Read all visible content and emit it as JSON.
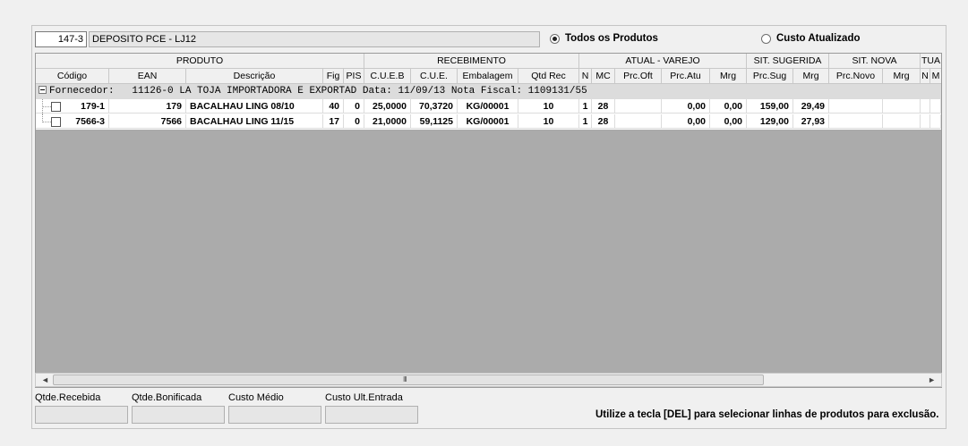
{
  "store": {
    "code": "147-3",
    "name": "DEPOSITO PCE - LJ12"
  },
  "filter": {
    "all_products": {
      "label": "Todos os Produtos",
      "selected": true
    },
    "updated_cost": {
      "label": "Custo Atualizado",
      "selected": false
    }
  },
  "grid": {
    "groups": [
      "PRODUTO",
      "RECEBIMENTO",
      "ATUAL - VAREJO",
      "SIT. SUGERIDA",
      "SIT. NOVA",
      "TUA"
    ],
    "columns": [
      "Código",
      "EAN",
      "Descrição",
      "Fig",
      "PIS",
      "C.U.E.B",
      "C.U.E.",
      "Embalagem",
      "Qtd Rec",
      "N",
      "MC",
      "Prc.Oft",
      "Prc.Atu",
      "Mrg",
      "Prc.Sug",
      "Mrg",
      "Prc.Novo",
      "Mrg",
      "N",
      "M"
    ],
    "supplier_row": "Fornecedor:   11126-0 LA TOJA IMPORTADORA E EXPORTAD Data: 11/09/13 Nota Fiscal: 1109131/55",
    "rows": [
      {
        "codigo": "179-1",
        "ean": "179",
        "descricao": "BACALHAU LING 08/10",
        "fig": "40",
        "pis": "0",
        "cueb": "25,0000",
        "cue": "70,3720",
        "embalagem": "KG/00001",
        "qtd_rec": "10",
        "n": "1",
        "mc": "28",
        "prc_oft": "",
        "prc_atu": "0,00",
        "mrg_atu": "0,00",
        "prc_sug": "159,00",
        "mrg_sug": "29,49",
        "prc_novo": "",
        "mrg_novo": ""
      },
      {
        "codigo": "7566-3",
        "ean": "7566",
        "descricao": "BACALHAU LING 11/15",
        "fig": "17",
        "pis": "0",
        "cueb": "21,0000",
        "cue": "59,1125",
        "embalagem": "KG/00001",
        "qtd_rec": "10",
        "n": "1",
        "mc": "28",
        "prc_oft": "",
        "prc_atu": "0,00",
        "mrg_atu": "0,00",
        "prc_sug": "129,00",
        "mrg_sug": "27,93",
        "prc_novo": "",
        "mrg_novo": ""
      }
    ]
  },
  "footer": {
    "labels": [
      "Qtde.Recebida",
      "Qtde.Bonificada",
      "Custo Médio",
      "Custo Ult.Entrada"
    ],
    "hint": "Utilize a tecla [DEL] para selecionar linhas de produtos para exclusão."
  },
  "scroll": {
    "grip": "III",
    "left": "◄",
    "right": "►"
  }
}
